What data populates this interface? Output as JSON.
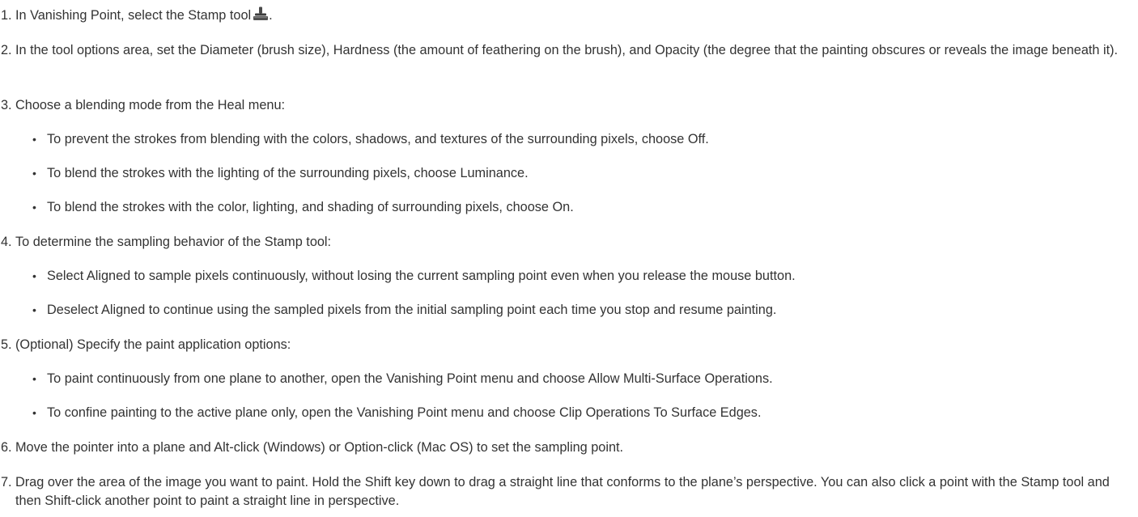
{
  "steps": [
    {
      "num": "1.",
      "text_before_icon": "In Vanishing Point, select the Stamp tool",
      "text_after_icon": ".",
      "icon": "stamp-tool-icon"
    },
    {
      "num": "2.",
      "text": "In the tool options area, set the Diameter (brush size), Hardness (the amount of feathering on the brush), and Opacity (the degree that the painting obscures or reveals the image beneath it)."
    },
    {
      "num": "3.",
      "text": "Choose a blending mode from the Heal menu:",
      "bullets": [
        "To prevent the strokes from blending with the colors, shadows, and textures of the surrounding pixels, choose Off.",
        "To blend the strokes with the lighting of the surrounding pixels, choose Luminance.",
        "To blend the strokes with the color, lighting, and shading of surrounding pixels, choose On."
      ]
    },
    {
      "num": "4.",
      "text": "To determine the sampling behavior of the Stamp tool:",
      "bullets": [
        "Select Aligned to sample pixels continuously, without losing the current sampling point even when you release the mouse button.",
        "Deselect Aligned to continue using the sampled pixels from the initial sampling point each time you stop and resume painting."
      ]
    },
    {
      "num": "5.",
      "text": "(Optional) Specify the paint application options:",
      "bullets": [
        "To paint continuously from one plane to another, open the Vanishing Point menu and choose Allow Multi-Surface Operations.",
        "To confine painting to the active plane only, open the Vanishing Point menu and choose Clip Operations To Surface Edges."
      ]
    },
    {
      "num": "6.",
      "text": "Move the pointer into a plane and Alt-click (Windows) or Option-click (Mac OS) to set the sampling point."
    },
    {
      "num": "7.",
      "text": "Drag over the area of the image you want to paint. Hold the Shift key down to drag a straight line that conforms to the plane’s perspective. You can also click a point with the Stamp tool and then Shift-click another point to paint a straight line in perspective."
    }
  ],
  "bullet_glyph": "•"
}
